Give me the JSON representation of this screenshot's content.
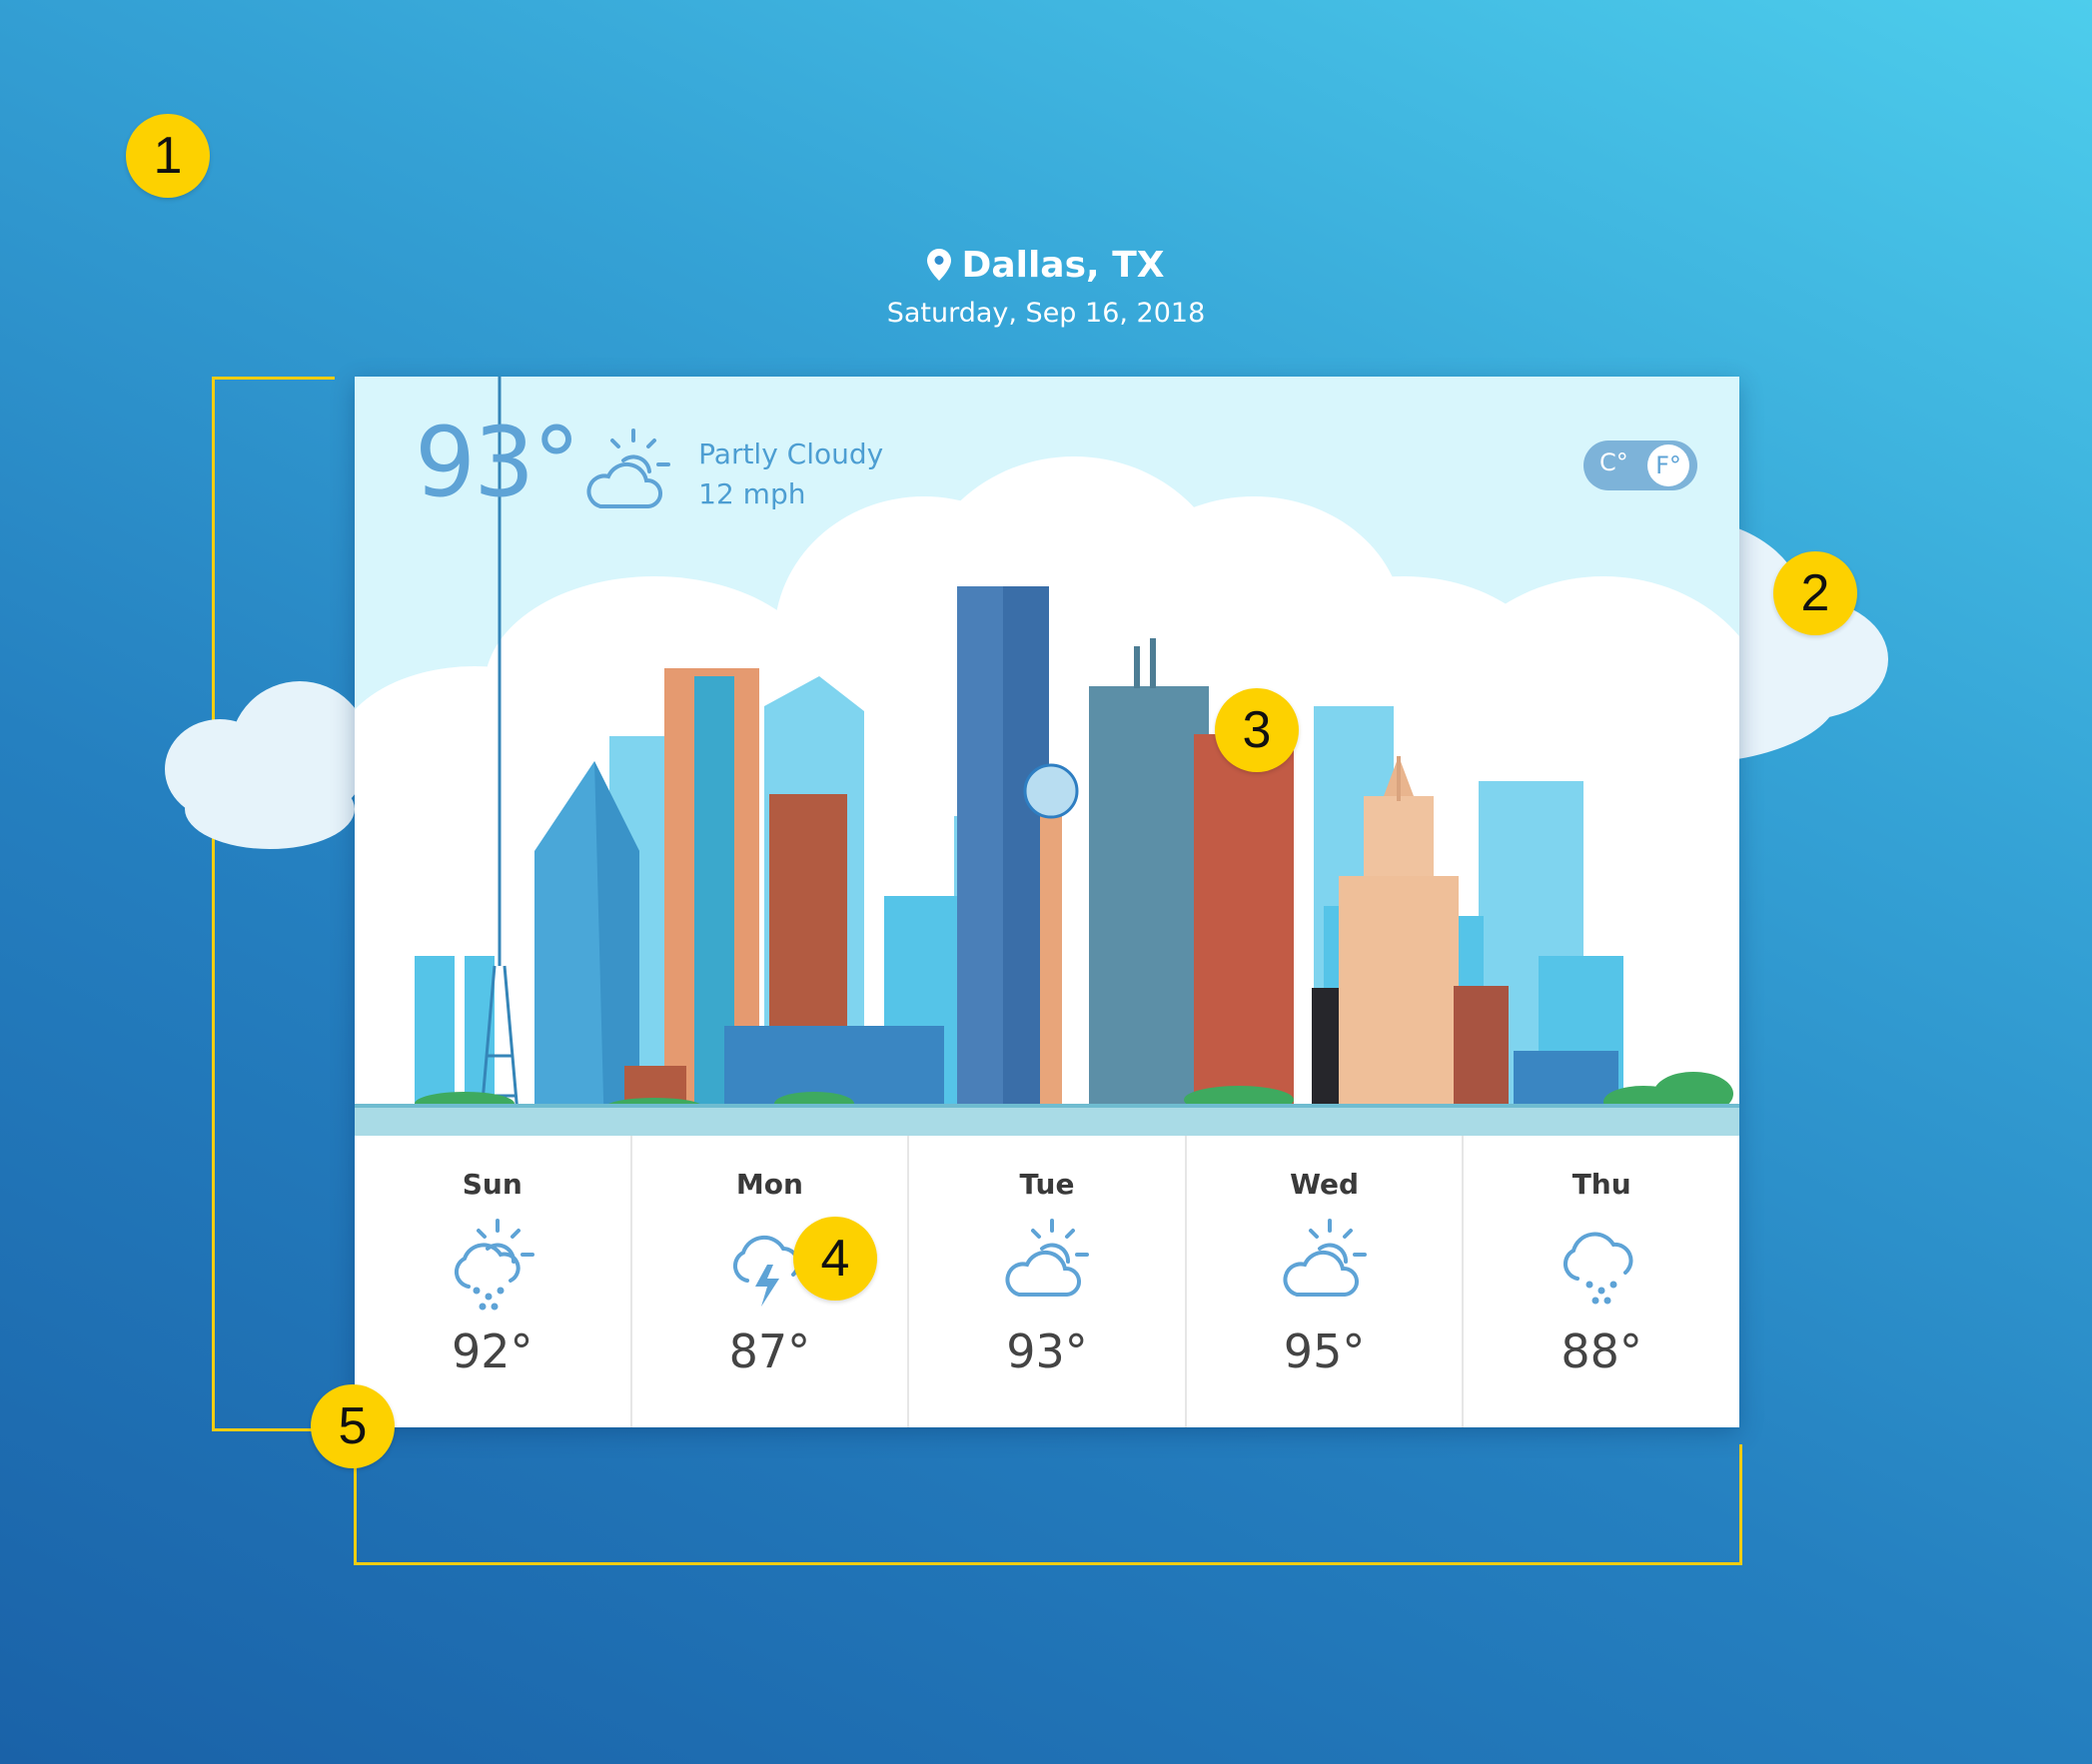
{
  "header": {
    "location": "Dallas, TX",
    "date": "Saturday, Sep 16, 2018",
    "pin_icon": "map-pin-icon"
  },
  "current": {
    "temperature": "93°",
    "condition": "Partly Cloudy",
    "wind": "12 mph",
    "icon": "partly-cloudy-icon"
  },
  "unit_toggle": {
    "celsius_label": "C°",
    "fahrenheit_label": "F°",
    "selected": "F"
  },
  "forecast": [
    {
      "day": "Sun",
      "temp": "92°",
      "icon": "partly-cloudy-rain-icon"
    },
    {
      "day": "Mon",
      "temp": "87°",
      "icon": "thunderstorm-icon"
    },
    {
      "day": "Tue",
      "temp": "93°",
      "icon": "partly-cloudy-icon"
    },
    {
      "day": "Wed",
      "temp": "95°",
      "icon": "partly-cloudy-icon"
    },
    {
      "day": "Thu",
      "temp": "88°",
      "icon": "rain-icon"
    }
  ],
  "annotations": [
    "1",
    "2",
    "3",
    "4",
    "5"
  ],
  "colors": {
    "accent": "#5ea3d6",
    "marker": "#fdd100",
    "bracket": "#f2cd12",
    "sky": "#d8f6fc"
  }
}
